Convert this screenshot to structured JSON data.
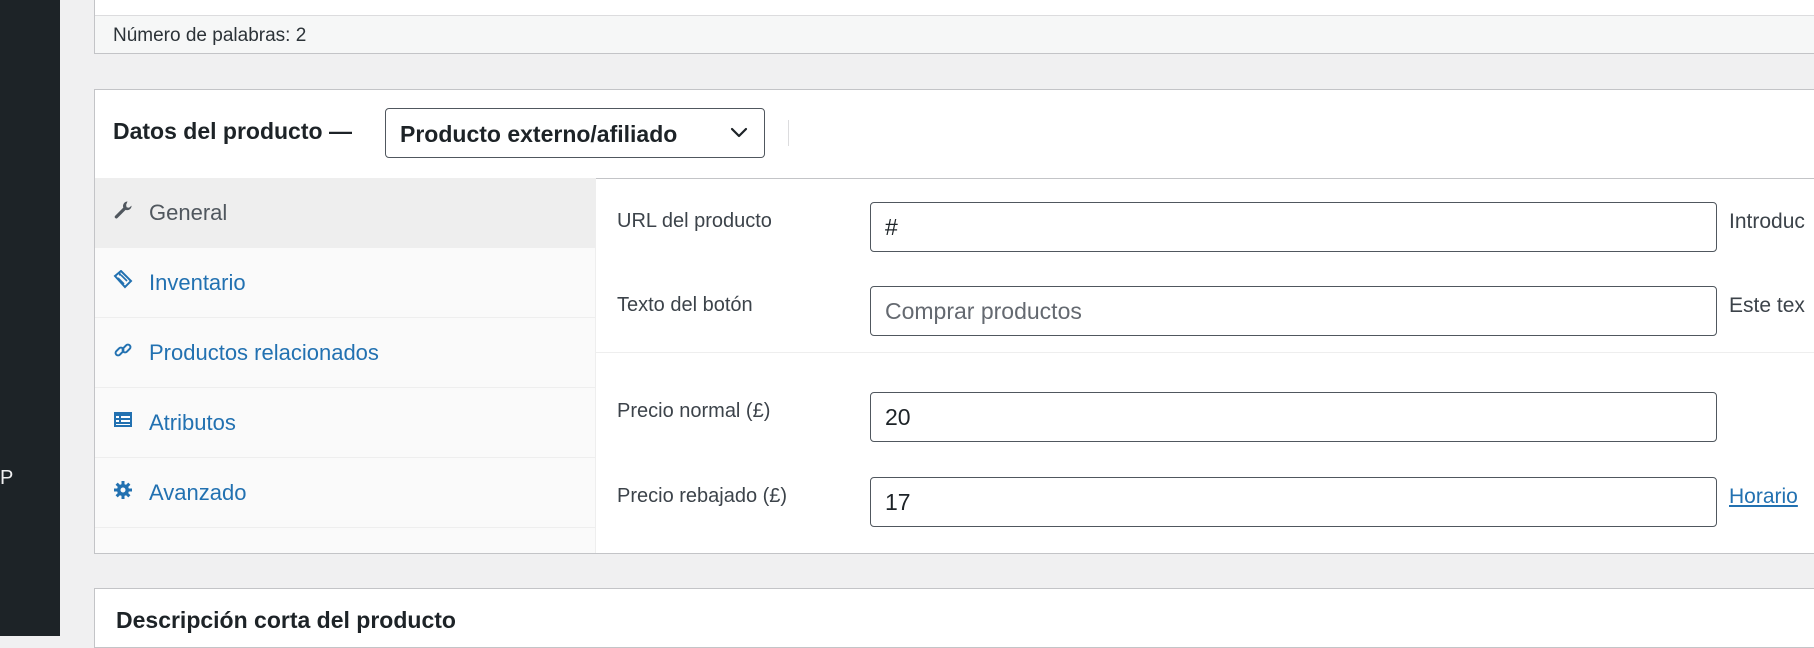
{
  "sidebar": {
    "partial_label": "P"
  },
  "word_count": {
    "text": "Número de palabras: 2"
  },
  "product_data": {
    "title": "Datos del producto —",
    "type_select": {
      "value": "Producto externo/afiliado",
      "icon": "chevron-down-icon"
    },
    "tabs": [
      {
        "label": "General",
        "icon": "wrench-icon",
        "active": true
      },
      {
        "label": "Inventario",
        "icon": "tag-icon",
        "active": false
      },
      {
        "label": "Productos relacionados",
        "icon": "link-icon",
        "active": false
      },
      {
        "label": "Atributos",
        "icon": "table-icon",
        "active": false
      },
      {
        "label": "Avanzado",
        "icon": "gear-icon",
        "active": false
      }
    ],
    "fields": {
      "product_url": {
        "label": "URL del producto",
        "value": "#",
        "desc": "Introduc"
      },
      "button_text": {
        "label": "Texto del botón",
        "placeholder": "Comprar productos",
        "desc": "Este tex"
      },
      "regular_price": {
        "label": "Precio normal (£)",
        "value": "20"
      },
      "sale_price": {
        "label": "Precio rebajado (£)",
        "value": "17",
        "link": "Horario"
      }
    }
  },
  "short_description": {
    "title": "Descripción corta del producto"
  },
  "colors": {
    "link": "#2271b1",
    "admin_sidebar": "#1d2327",
    "active_tab": "#eeeeee",
    "border": "#c3c4c7"
  }
}
